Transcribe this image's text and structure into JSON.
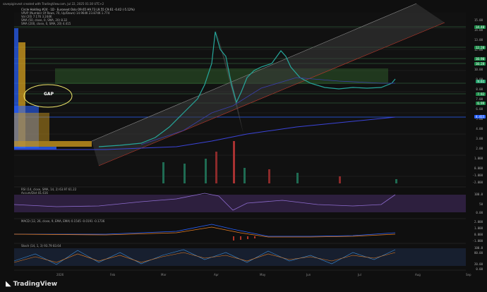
{
  "header": {
    "text": "savepiginvest created with TradingView.com, Jul 22, 2025 01:30 UTC+2"
  },
  "legends": {
    "l1": "Circle Holding #24 · 1D · Euronext Oslo  O9.65 H9.73 L9.55 C9.61 -0.42 (-5.12%)",
    "l2": "VRVP (Number Of Rows, 70, Up/Down)  14.964K  23.874K  1.774",
    "l3": "Vol (20)  7.176  3.244K",
    "l4": "SMA (50, close, 0, SMA, 20)  8.32",
    "l5": "SMA (200, close, 0, SMA, 20)  4.415",
    "rsi": "RSI (14, close, SMA, 14, 2)  63.97  61.22",
    "rsi2": "Accum/Dist  81.616",
    "macd": "MACD (12, 26, close, 9, EMA, EMA)  0.1545  -0.0191  -0.1736",
    "stoch": "Stoch (14, 1, 3)  93.79  83.64"
  },
  "annotation": {
    "gap": "GAP"
  },
  "price_axis": [
    "15.00",
    "14.00",
    "13.00",
    "12.00",
    "11.00",
    "10.00",
    "9.00",
    "8.00",
    "7.00",
    "6.00",
    "5.00",
    "4.00",
    "3.00",
    "2.00",
    "1.000",
    "0.000",
    "-1.000",
    "-2.000"
  ],
  "price_tags": [
    {
      "label": "14.40",
      "color": "#1e8c4a"
    },
    {
      "label": "12.20",
      "color": "#1e8c4a"
    },
    {
      "label": "10.90",
      "color": "#1e8c4a"
    },
    {
      "label": "10.28",
      "color": "#1e8c4a"
    },
    {
      "label": "9.61",
      "color": "#22a06b"
    },
    {
      "label": "7.92",
      "color": "#1e8c4a"
    },
    {
      "label": "6.99",
      "color": "#1e8c4a"
    },
    {
      "label": "4.415",
      "color": "#2962ff"
    }
  ],
  "rsi_axis": [
    "100.0",
    "50",
    "0.00"
  ],
  "macd_axis": [
    "2.000",
    "1.000",
    "0.000",
    "-1.000"
  ],
  "stoch_axis": [
    "100.0",
    "80.00",
    "20.00",
    "0.00"
  ],
  "x_axis": [
    "2026",
    "Feb",
    "Mar",
    "Apr",
    "May",
    "Jun",
    "Jul",
    "Aug",
    "Sep"
  ],
  "brand": "TradingView"
}
